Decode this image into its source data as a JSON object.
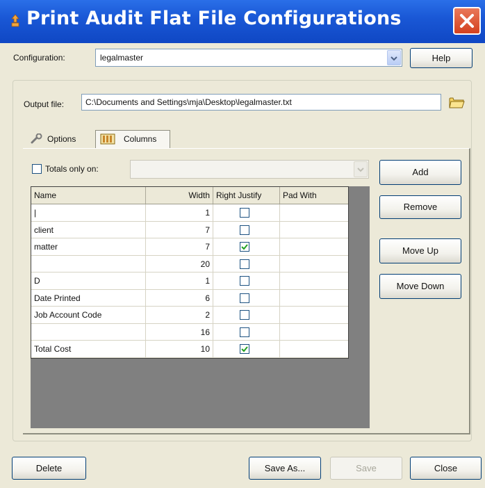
{
  "window": {
    "title": "Print Audit Flat File Configurations"
  },
  "config": {
    "label": "Configuration:",
    "value": "legalmaster",
    "help_label": "Help"
  },
  "output": {
    "label": "Output file:",
    "path": "C:\\Documents and Settings\\mja\\Desktop\\legalmaster.txt"
  },
  "tabs": [
    {
      "label": "Options",
      "icon": "wrench-icon",
      "selected": false
    },
    {
      "label": "Columns",
      "icon": "columns-icon",
      "selected": true
    }
  ],
  "totals": {
    "label": "Totals only on:",
    "checked": false,
    "value": ""
  },
  "grid": {
    "headers": [
      "Name",
      "Width",
      "Right Justify",
      "Pad With"
    ],
    "rows": [
      {
        "name": "|",
        "width": "1",
        "right_justify": false,
        "pad_with": ""
      },
      {
        "name": "client",
        "width": "7",
        "right_justify": false,
        "pad_with": ""
      },
      {
        "name": "matter",
        "width": "7",
        "right_justify": true,
        "pad_with": ""
      },
      {
        "name": "",
        "width": "20",
        "right_justify": false,
        "pad_with": ""
      },
      {
        "name": "D",
        "width": "1",
        "right_justify": false,
        "pad_with": ""
      },
      {
        "name": "Date Printed",
        "width": "6",
        "right_justify": false,
        "pad_with": ""
      },
      {
        "name": "Job Account Code",
        "width": "2",
        "right_justify": false,
        "pad_with": ""
      },
      {
        "name": "",
        "width": "16",
        "right_justify": false,
        "pad_with": ""
      },
      {
        "name": "Total Cost",
        "width": "10",
        "right_justify": true,
        "pad_with": ""
      }
    ]
  },
  "side_buttons": {
    "add": "Add",
    "remove": "Remove",
    "move_up": "Move Up",
    "move_down": "Move Down"
  },
  "footer": {
    "delete": "Delete",
    "save_as": "Save As...",
    "save": "Save",
    "close": "Close"
  },
  "colors": {
    "titlebar": "#1a58d6",
    "close_button": "#d4411f",
    "window_bg": "#ece9d8",
    "check": "#21a121"
  }
}
